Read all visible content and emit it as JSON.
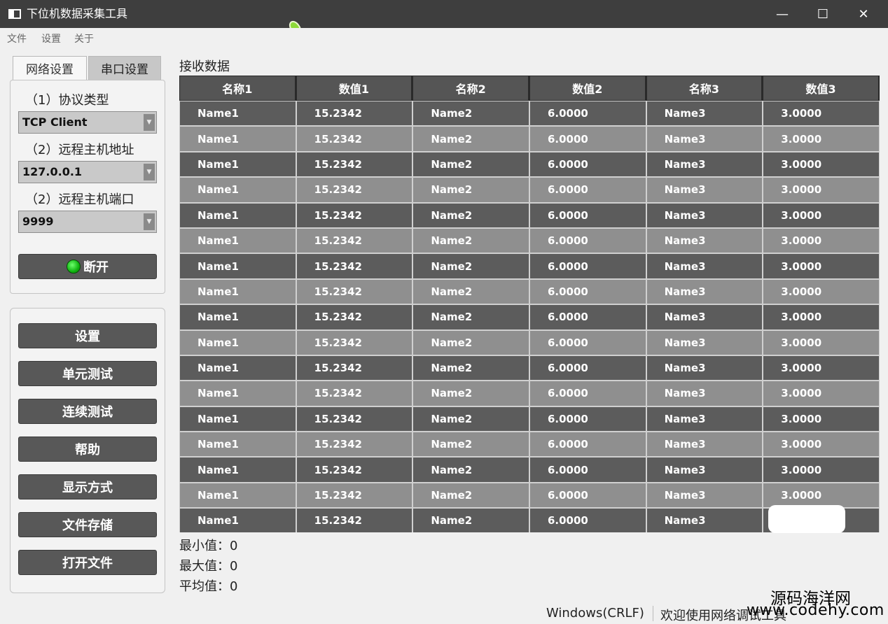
{
  "window": {
    "title": "下位机数据采集工具",
    "controls": {
      "minimize": "—",
      "maximize": "☐",
      "close": "✕"
    }
  },
  "menu": [
    {
      "label": "文件"
    },
    {
      "label": "设置"
    },
    {
      "label": "关于"
    }
  ],
  "tabs": [
    {
      "label": "网络设置",
      "active": true
    },
    {
      "label": "串口设置",
      "active": false
    }
  ],
  "network": {
    "protocol_label": "（1）协议类型",
    "protocol_value": "TCP Client",
    "host_label": "（2）远程主机地址",
    "host_value": "127.0.0.1",
    "port_label": "（2）远程主机端口",
    "port_value": "9999",
    "connect_button": "断开",
    "connect_status_color": "#19c219"
  },
  "actions": [
    {
      "label": "设置"
    },
    {
      "label": "单元测试"
    },
    {
      "label": "连续测试"
    },
    {
      "label": "帮助"
    },
    {
      "label": "显示方式"
    },
    {
      "label": "文件存储"
    },
    {
      "label": "打开文件"
    }
  ],
  "receive": {
    "title": "接收数据",
    "columns": [
      "名称1",
      "数值1",
      "名称2",
      "数值2",
      "名称3",
      "数值3"
    ],
    "rows": [
      [
        "Name1",
        "15.2342",
        "Name2",
        "6.0000",
        "Name3",
        "3.0000"
      ],
      [
        "Name1",
        "15.2342",
        "Name2",
        "6.0000",
        "Name3",
        "3.0000"
      ],
      [
        "Name1",
        "15.2342",
        "Name2",
        "6.0000",
        "Name3",
        "3.0000"
      ],
      [
        "Name1",
        "15.2342",
        "Name2",
        "6.0000",
        "Name3",
        "3.0000"
      ],
      [
        "Name1",
        "15.2342",
        "Name2",
        "6.0000",
        "Name3",
        "3.0000"
      ],
      [
        "Name1",
        "15.2342",
        "Name2",
        "6.0000",
        "Name3",
        "3.0000"
      ],
      [
        "Name1",
        "15.2342",
        "Name2",
        "6.0000",
        "Name3",
        "3.0000"
      ],
      [
        "Name1",
        "15.2342",
        "Name2",
        "6.0000",
        "Name3",
        "3.0000"
      ],
      [
        "Name1",
        "15.2342",
        "Name2",
        "6.0000",
        "Name3",
        "3.0000"
      ],
      [
        "Name1",
        "15.2342",
        "Name2",
        "6.0000",
        "Name3",
        "3.0000"
      ],
      [
        "Name1",
        "15.2342",
        "Name2",
        "6.0000",
        "Name3",
        "3.0000"
      ],
      [
        "Name1",
        "15.2342",
        "Name2",
        "6.0000",
        "Name3",
        "3.0000"
      ],
      [
        "Name1",
        "15.2342",
        "Name2",
        "6.0000",
        "Name3",
        "3.0000"
      ],
      [
        "Name1",
        "15.2342",
        "Name2",
        "6.0000",
        "Name3",
        "3.0000"
      ],
      [
        "Name1",
        "15.2342",
        "Name2",
        "6.0000",
        "Name3",
        "3.0000"
      ],
      [
        "Name1",
        "15.2342",
        "Name2",
        "6.0000",
        "Name3",
        "3.0000"
      ],
      [
        "Name1",
        "15.2342",
        "Name2",
        "6.0000",
        "Name3",
        ""
      ]
    ]
  },
  "stats": {
    "min": "最小值：0",
    "max": "最大值：0",
    "avg": "平均值：0"
  },
  "statusbar": {
    "eol": "Windows(CRLF)",
    "message": "欢迎使用网络调试工具"
  },
  "watermark": {
    "cn": "源码海洋网",
    "en": "www.codehy.com"
  }
}
